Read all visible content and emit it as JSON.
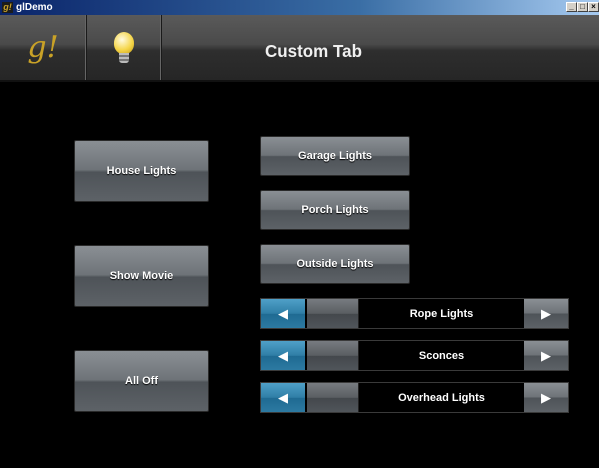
{
  "window": {
    "title": "glDemo",
    "app_icon_glyph": "g!",
    "controls": {
      "minimize": "_",
      "maximize": "□",
      "close": "×"
    }
  },
  "header": {
    "logo_text": "g!",
    "logo_color": "#c9a227",
    "icon": "lightbulb-icon",
    "title": "Custom Tab"
  },
  "buttons_left": [
    {
      "label": "House Lights"
    },
    {
      "label": "Show Movie"
    },
    {
      "label": "All Off"
    }
  ],
  "buttons_right": [
    {
      "label": "Garage Lights"
    },
    {
      "label": "Porch Lights"
    },
    {
      "label": "Outside Lights"
    }
  ],
  "sliders": [
    {
      "label": "Rope Lights",
      "left_icon": "left-arrow-icon",
      "right_icon": "right-arrow-icon"
    },
    {
      "label": "Sconces",
      "left_icon": "left-arrow-icon",
      "right_icon": "right-arrow-icon"
    },
    {
      "label": "Overhead Lights",
      "left_icon": "left-arrow-icon",
      "right_icon": "right-arrow-icon"
    }
  ],
  "arrows": {
    "left": "◀",
    "right": "▶"
  },
  "colors": {
    "accent_blue": "#2f7ea6",
    "button_gray": "#6e7378",
    "background": "#000000"
  }
}
